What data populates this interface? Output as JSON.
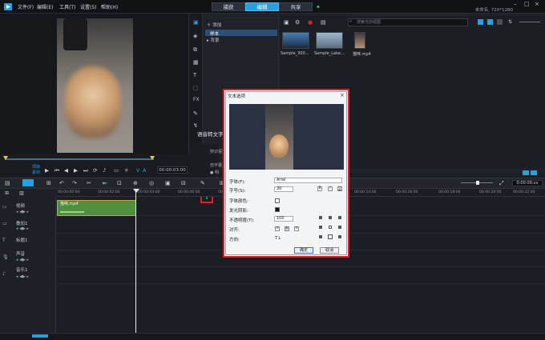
{
  "menu": {
    "file": "文件(F)",
    "edit": "编辑(E)",
    "tools": "工具(T)",
    "settings": "设置(S)",
    "help": "帮助(H)"
  },
  "modes": {
    "capture": "捕获",
    "edit": "编辑",
    "share": "共享"
  },
  "project": {
    "label": "未命名, 720*1280"
  },
  "preview": {
    "timecode": "00:00:03:00",
    "project_label": "项目",
    "clip_label": "素材"
  },
  "library": {
    "add_label": "添加",
    "folders": [
      "样本",
      "背景"
    ],
    "search_placeholder": "搜索当前视图",
    "thumbs": [
      {
        "label": "Sample_300..."
      },
      {
        "label": "Sample_Lake..."
      },
      {
        "label": "猫咪.mp4"
      }
    ]
  },
  "subtitle_panel": {
    "speech_to_text": "语音转文字",
    "lines": [
      "辨识语言",
      "自字幕文",
      "明",
      "字"
    ]
  },
  "timeline": {
    "ruler": [
      "00:00:00:00",
      "00:00:02:00",
      "00:00:04:00",
      "00:00:06:00",
      "00:00:08:00",
      "00:00:10:00",
      "00:00:12:00",
      "00:00:14:00",
      "00:00:16:00",
      "00:00:18:00",
      "00:00:20:00",
      "00:00:22:00"
    ],
    "timecode": "0:00:09:xx",
    "tracks": [
      {
        "name": "视频"
      },
      {
        "name": "叠加1"
      },
      {
        "name": "标题1"
      },
      {
        "name": "声音"
      },
      {
        "name": "音乐1"
      }
    ],
    "clip_label": "猫咪.mp4"
  },
  "dialog": {
    "title": "文本选项",
    "font_label": "字体(F):",
    "font_value": "Arial",
    "size_label": "字号(S):",
    "size_value": "30",
    "color_label": "字体颜色:",
    "shadow_label": "发光阴影:",
    "opacity_label": "不透明度(T):",
    "opacity_value": "100",
    "align_label": "对齐:",
    "direction_label": "方向:",
    "direction_value": "T↓",
    "bold": "B",
    "italic": "I",
    "underline": "U",
    "ok": "确定",
    "cancel": "取消",
    "close": "×"
  },
  "colors": {
    "accent": "#2a9fe0",
    "highlight": "#d8202a",
    "clip": "#4f8f3e"
  }
}
